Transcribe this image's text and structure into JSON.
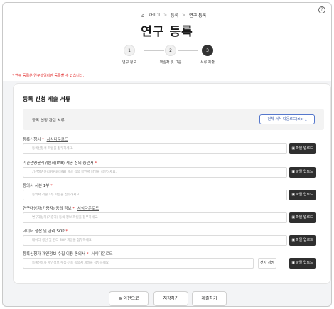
{
  "header": {
    "help_icon": "question-circle-icon",
    "breadcrumb": {
      "home_icon": "home-icon",
      "home": "KHIDI",
      "section": "등록",
      "current": "연구 등록",
      "separator": ">"
    },
    "page_title": "연구 등록"
  },
  "stepper": {
    "steps": [
      {
        "number": "1",
        "label": "연구 정보",
        "active": false
      },
      {
        "number": "2",
        "label": "책임자 및 그룹",
        "active": false
      },
      {
        "number": "3",
        "label": "서류 제출",
        "active": true
      }
    ]
  },
  "notice": "* 연구 등록은 연구책임자만 등록할 수 있습니다.",
  "card": {
    "title": "등록 신청 제출 서류",
    "guide_label": "등록 신청 관련 서류",
    "download_all": "전체 서식 다운로드(zip)",
    "download_icon": "download-icon",
    "fields": [
      {
        "label": "등록신청서",
        "required": "*",
        "template_link": "서식다운로드",
        "placeholder": "등록신청서 파일을 첨부하세요.",
        "upload": "파일 업로드"
      },
      {
        "label": "기관생명윤리위원회(IRB) 제공 심의 승인서",
        "required": "*",
        "template_link": "",
        "placeholder": "기관생명윤리위원회(IRB) 제공 심의 승인서 파일을 첨부하세요.",
        "upload": "파일 업로드"
      },
      {
        "label": "동의서 서본 1부",
        "required": "*",
        "template_link": "",
        "placeholder": "동의서 서본 1부 파일을 첨부하세요.",
        "upload": "파일 업로드"
      },
      {
        "label": "연구대상자(기증자) 동의 정보",
        "required": "*",
        "template_link": "서식다운로드",
        "placeholder": "연구대상자(기증자) 동의 정보 파일을 첨부하세요.",
        "upload": "파일 업로드"
      },
      {
        "label": "데이터 생산 및 관리 SOP",
        "required": "*",
        "template_link": "",
        "placeholder": "데이터 생산 및 관리 SOP 파일을 첨부하세요.",
        "upload": "파일 업로드"
      },
      {
        "label": "등록신청자 개인정보 수집·이용 동의서",
        "required": "*",
        "template_link": "서식다운로드",
        "placeholder": "등록신청자 개인정보 수집·이용 동의서 파일을 첨부하세요.",
        "upload": "파일 업로드",
        "esign": "전자 서명"
      }
    ],
    "upload_icon": "file-icon"
  },
  "footer": {
    "prev": "이전으로",
    "prev_icon": "arrow-left-circle-icon",
    "save": "저장하기",
    "submit": "제출하기"
  }
}
